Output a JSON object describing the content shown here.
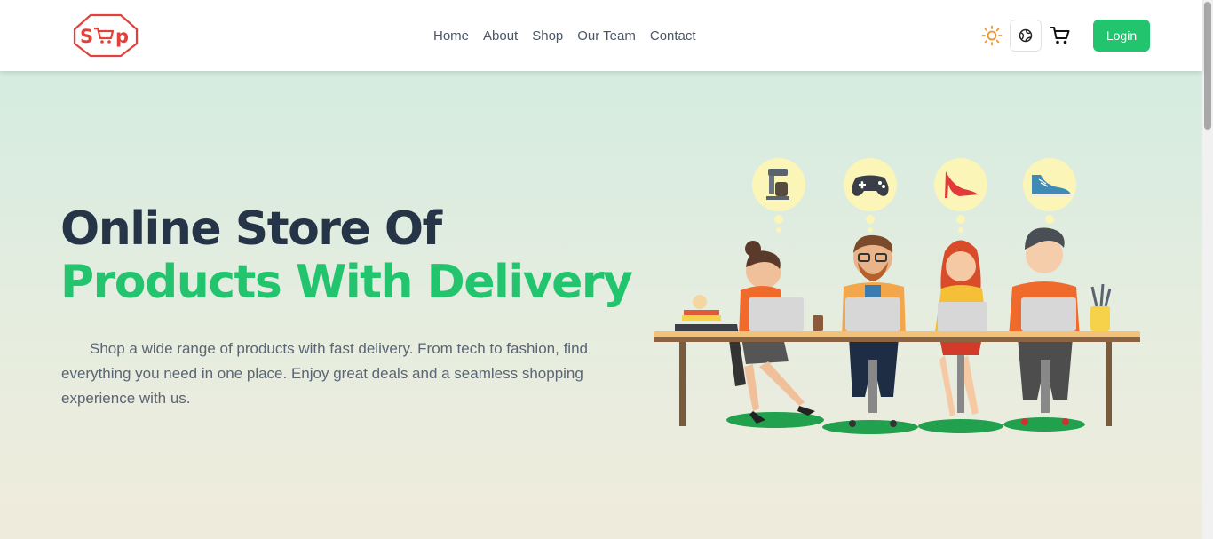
{
  "brand": {
    "logo_text": "Shop",
    "colors": {
      "brand_red": "#e0413a",
      "accent_green": "#22c56e",
      "heading_dark": "#253447"
    }
  },
  "nav": {
    "links": [
      {
        "label": "Home"
      },
      {
        "label": "About"
      },
      {
        "label": "Shop"
      },
      {
        "label": "Our Team"
      },
      {
        "label": "Contact"
      }
    ],
    "theme_toggle_icon": "sun-icon",
    "language_icon": "globe-icon",
    "cart_icon": "cart-icon",
    "login_label": "Login"
  },
  "hero": {
    "title_line1": "Online Store Of",
    "title_line2": "Products With Delivery",
    "description": "Shop a wide range of products with fast delivery. From tech to fashion, find everything you need in one place. Enjoy great deals and a seamless shopping experience with us.",
    "illustration_items": [
      "coffee-maker-icon",
      "gamepad-icon",
      "high-heel-icon",
      "sneaker-icon"
    ]
  }
}
